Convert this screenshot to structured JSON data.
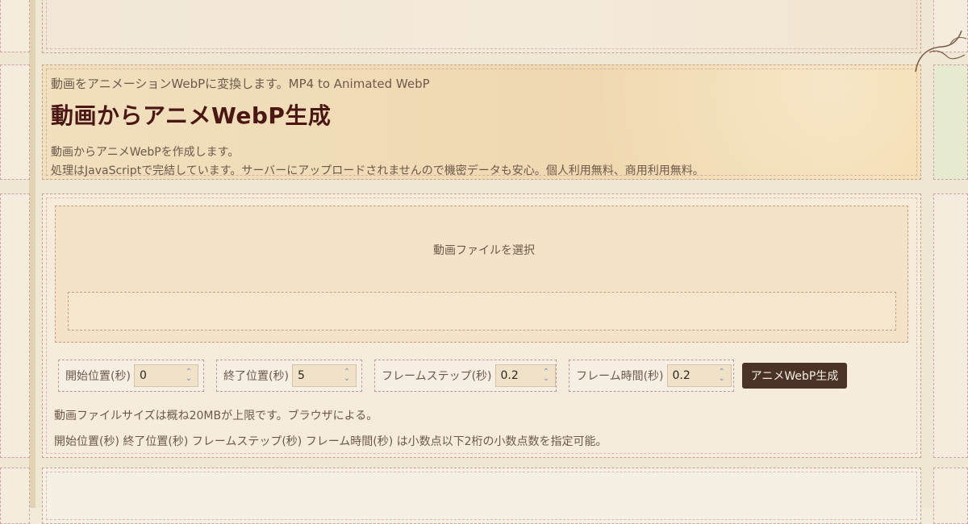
{
  "header": {
    "subtitle": "動画をアニメーションWebPに変換します。MP4 to Animated WebP",
    "title": "動画からアニメWebP生成",
    "description_line1": "動画からアニメWebPを作成します。",
    "description_line2": "処理はJavaScriptで完結しています。サーバーにアップロードされませんので機密データも安心。個人利用無料、商用利用無料。"
  },
  "upload": {
    "label": "動画ファイルを選択"
  },
  "controls": {
    "start": {
      "label": "開始位置(秒)",
      "value": "0"
    },
    "end": {
      "label": "終了位置(秒)",
      "value": "5"
    },
    "step": {
      "label": "フレームステップ(秒)",
      "value": "0.2"
    },
    "frame_time": {
      "label": "フレーム時間(秒)",
      "value": "0.2"
    },
    "generate_label": "アニメWebP生成"
  },
  "notes": {
    "size_limit": "動画ファイルサイズは概ね20MBが上限です。ブラウザによる。",
    "decimals": "開始位置(秒) 終了位置(秒) フレームステップ(秒) フレーム時間(秒) は小数点以下2桁の小数点数を指定可能。"
  },
  "icons": {
    "spin": "stepper-icon",
    "decor": "vine-decoration-icon"
  },
  "colors": {
    "title": "#4a1713",
    "button_bg": "#4a3226",
    "header_bg": "#f1dfbe",
    "accent_green": "#e6ebcf"
  }
}
